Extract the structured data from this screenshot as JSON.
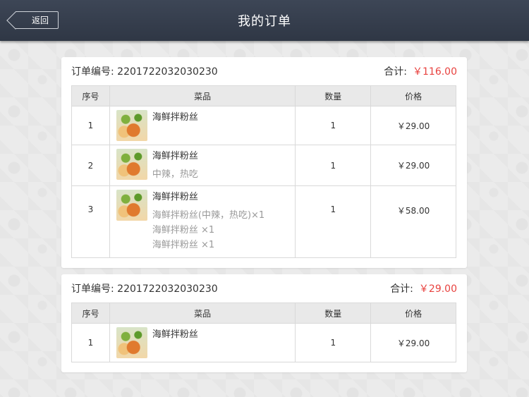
{
  "header": {
    "title": "我的订单",
    "back_label": "返回"
  },
  "orders": [
    {
      "order_no_text": "订单编号:  2201722032030230",
      "total_label": "合计:",
      "total_amount": "￥116.00",
      "columns": [
        "序号",
        "菜品",
        "数量",
        "价格"
      ],
      "rows": [
        {
          "no": "1",
          "name": "海鲜拌粉丝",
          "notes": [],
          "qty": "1",
          "price": "￥29.00"
        },
        {
          "no": "2",
          "name": "海鲜拌粉丝",
          "notes": [
            "中辣，热吃"
          ],
          "qty": "1",
          "price": "￥29.00"
        },
        {
          "no": "3",
          "name": "海鲜拌粉丝",
          "notes": [
            "海鲜拌粉丝(中辣，热吃)×1",
            "海鲜拌粉丝 ×1",
            "海鲜拌粉丝 ×1"
          ],
          "qty": "1",
          "price": "￥58.00"
        }
      ]
    },
    {
      "order_no_text": "订单编号:  2201722032030230",
      "total_label": "合计:",
      "total_amount": "￥29.00",
      "columns": [
        "序号",
        "菜品",
        "数量",
        "价格"
      ],
      "rows": [
        {
          "no": "1",
          "name": "海鲜拌粉丝",
          "notes": [],
          "qty": "1",
          "price": "￥29.00"
        }
      ]
    }
  ],
  "colors": {
    "topbar": "#353e4d",
    "accent_price": "#e8423f"
  }
}
